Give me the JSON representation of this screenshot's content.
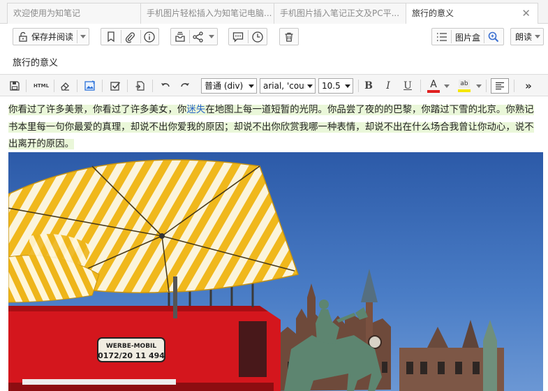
{
  "tabs": [
    {
      "label": "欢迎使用为知笔记"
    },
    {
      "label": "手机图片轻松插入为知笔记电脑..."
    },
    {
      "label": "手机图片插入笔记正文及PC平..."
    },
    {
      "label": "旅行的意义",
      "active": true
    }
  ],
  "toolbar": {
    "save_read_label": "保存并阅读",
    "image_box_label": "图片盒",
    "read_label": "朗读"
  },
  "note": {
    "title": "旅行的意义",
    "paragraph": {
      "part1": "你看过了许多美景，你看过了许多美女，你",
      "link": "迷失",
      "part2": "在地图上每一道短暂的光阴。你品尝了夜的的巴黎，你踏过下雪的北京。你熟记书本里每一句你最爱的真理，却说不出你爱我的原因；却说不出你欣赏我哪一种表情，却说不出在什么场合我曾让你动心，说不出离开的原因。"
    }
  },
  "editor": {
    "html_label": "HTML",
    "block_format": "普通 (div)",
    "font_family": "arial, 'cour",
    "font_size": "10.5",
    "bold": "B",
    "italic": "I",
    "underline": "U",
    "font_color_glyph": "A",
    "highlight_glyph": "ab",
    "more_glyph": "»"
  },
  "photo": {
    "sign_text_1": "WERBE-MOBIL",
    "sign_text_2": "0172/20 11 494"
  },
  "colors": {
    "font_color": "#e02020",
    "highlight_color": "#f5e600",
    "link": "#2a66c8",
    "highlight_bg": "#eaf7d9"
  }
}
